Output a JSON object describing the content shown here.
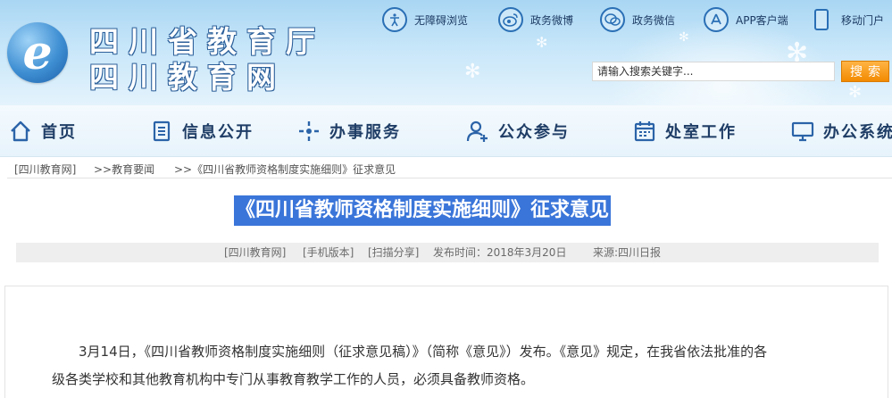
{
  "header": {
    "logo_letter": "e",
    "site_title_line1": "四川省教育厅",
    "site_title_line2": "四川教育网",
    "quick_links": [
      {
        "label": "无障碍浏览",
        "icon": "accessibility-icon"
      },
      {
        "label": "政务微博",
        "icon": "weibo-icon"
      },
      {
        "label": "政务微信",
        "icon": "wechat-icon"
      },
      {
        "label": "APP客户端",
        "icon": "app-store-icon"
      },
      {
        "label": "移动门户",
        "icon": "mobile-phone-icon"
      }
    ],
    "search": {
      "placeholder": "请输入搜索关键字...",
      "button_label": "搜索"
    }
  },
  "nav": {
    "items": [
      {
        "label": "首页",
        "icon": "home-icon"
      },
      {
        "label": "信息公开",
        "icon": "document-icon"
      },
      {
        "label": "办事服务",
        "icon": "service-icon"
      },
      {
        "label": "公众参与",
        "icon": "user-add-icon"
      },
      {
        "label": "处室工作",
        "icon": "calendar-icon"
      },
      {
        "label": "办公系统",
        "icon": "monitor-icon"
      }
    ]
  },
  "breadcrumb": {
    "items": [
      "[四川教育网]",
      ">>教育要闻",
      ">>《四川省教师资格制度实施细则》征求意见"
    ]
  },
  "article": {
    "title": "《四川省教师资格制度实施细则》征求意见",
    "meta": {
      "site": "[四川教育网]",
      "mobile": "[手机版本]",
      "share": "[扫描分享]",
      "published": "发布时间：2018年3月20日",
      "source": "来源:四川日报"
    },
    "paragraph1_line1": "3月14日，《四川省教师资格制度实施细则（征求意见稿）》（简称《意见》）发布。《意见》规定，在我省依法批准的各",
    "paragraph1_line2": "级各类学校和其他教育机构中专门从事教育教学工作的人员，必须具备教师资格。"
  },
  "colors": {
    "header_sky": "#a9d6f3",
    "nav_text": "#1f3d66",
    "icon_blue": "#2b63a8",
    "title_highlight": "#3a75d9",
    "search_button": "#f28a00"
  }
}
